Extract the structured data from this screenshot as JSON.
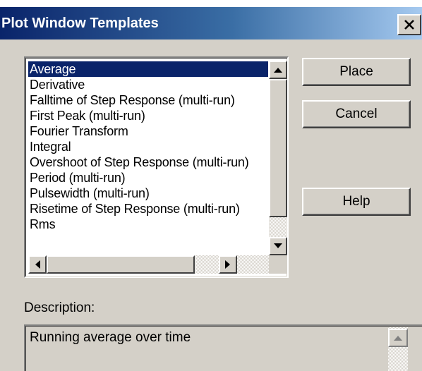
{
  "window": {
    "title": "Plot Window Templates",
    "close_glyph": "×"
  },
  "templates": {
    "items": [
      "Average",
      "Derivative",
      "Falltime of Step Response (multi-run)",
      "First Peak (multi-run)",
      "Fourier Transform",
      "Integral",
      "Overshoot of Step Response (multi-run)",
      "Period (multi-run)",
      "Pulsewidth (multi-run)",
      "Risetime of Step Response (multi-run)",
      "Rms"
    ],
    "selected": "Average"
  },
  "buttons": {
    "place": "Place",
    "cancel": "Cancel",
    "help": "Help"
  },
  "description": {
    "label": "Description:",
    "text": "Running average over time"
  },
  "icons": {
    "close": "close-icon",
    "scroll_up": "arrow-up-icon",
    "scroll_down": "arrow-down-icon",
    "scroll_left": "arrow-left-icon",
    "scroll_right": "arrow-right-icon"
  },
  "colors": {
    "titlebar_start": "#0a246a",
    "titlebar_end": "#a6caf0",
    "selection": "#0a246a",
    "face": "#d4d0c8"
  }
}
